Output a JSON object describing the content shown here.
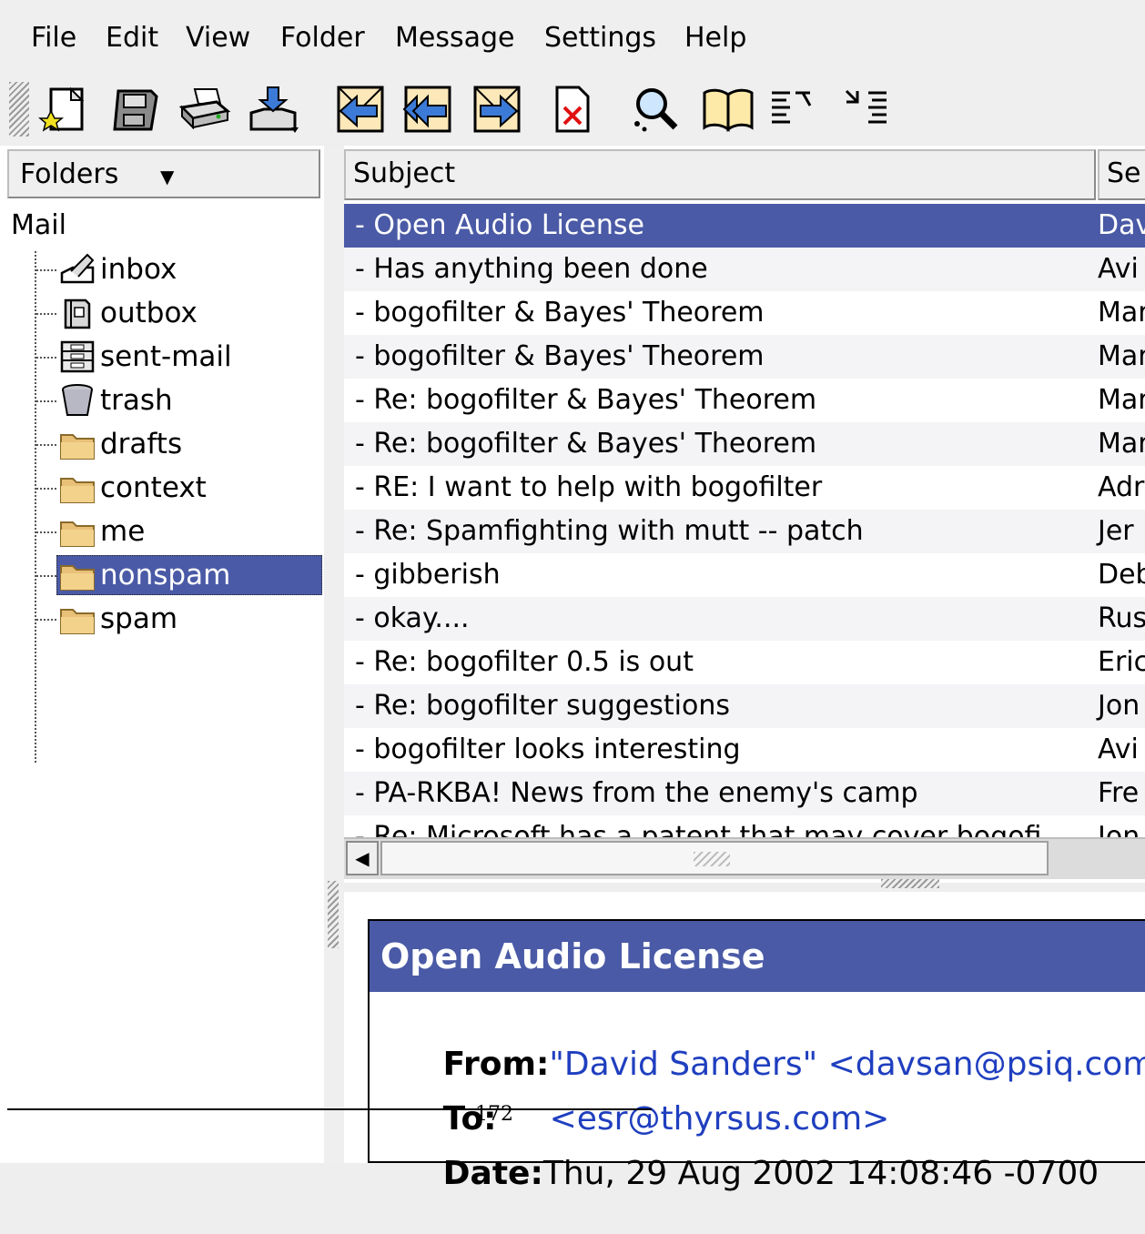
{
  "menubar": {
    "items": [
      "File",
      "Edit",
      "View",
      "Folder",
      "Message",
      "Settings",
      "Help"
    ]
  },
  "toolbar": {
    "buttons": [
      {
        "name": "new-message-icon"
      },
      {
        "name": "save-icon"
      },
      {
        "name": "print-icon"
      },
      {
        "name": "check-mail-icon"
      },
      {
        "name": "reply-icon"
      },
      {
        "name": "reply-all-icon"
      },
      {
        "name": "forward-icon"
      },
      {
        "name": "delete-icon"
      },
      {
        "name": "search-icon"
      },
      {
        "name": "address-book-icon"
      },
      {
        "name": "previous-unread-icon"
      },
      {
        "name": "next-unread-icon"
      }
    ]
  },
  "folders": {
    "header": "Folders",
    "root": "Mail",
    "items": [
      {
        "label": "inbox",
        "icon": "inbox-icon"
      },
      {
        "label": "outbox",
        "icon": "outbox-icon"
      },
      {
        "label": "sent-mail",
        "icon": "sent-mail-icon"
      },
      {
        "label": "trash",
        "icon": "trash-icon"
      },
      {
        "label": "drafts",
        "icon": "folder-icon"
      },
      {
        "label": "context",
        "icon": "folder-icon"
      },
      {
        "label": "me",
        "icon": "folder-icon"
      },
      {
        "label": "nonspam",
        "icon": "folder-icon",
        "selected": true
      },
      {
        "label": "spam",
        "icon": "folder-icon"
      }
    ]
  },
  "messages": {
    "columns": [
      "Subject",
      "Se"
    ],
    "rows": [
      {
        "subject": "- Open Audio License",
        "sender": "Dav",
        "selected": true
      },
      {
        "subject": "- Has anything been done",
        "sender": "Avi"
      },
      {
        "subject": "- bogofilter & Bayes' Theorem",
        "sender": "Mar"
      },
      {
        "subject": "- bogofilter & Bayes' Theorem",
        "sender": "Mar"
      },
      {
        "subject": "- Re: bogofilter & Bayes' Theorem",
        "sender": "Mar"
      },
      {
        "subject": "- Re: bogofilter & Bayes' Theorem",
        "sender": "Mar"
      },
      {
        "subject": "- RE: I want to help with bogofilter",
        "sender": "Adr"
      },
      {
        "subject": "- Re: Spamfighting with mutt -- patch",
        "sender": "Jer"
      },
      {
        "subject": "- gibberish",
        "sender": "Deb"
      },
      {
        "subject": "- okay....",
        "sender": "Rus"
      },
      {
        "subject": "- Re: bogofilter 0.5 is out",
        "sender": "Eric"
      },
      {
        "subject": "- Re: bogofilter suggestions",
        "sender": "Jon"
      },
      {
        "subject": "- bogofilter looks interesting",
        "sender": "Avi"
      },
      {
        "subject": "- PA-RKBA! News from the enemy's camp",
        "sender": "Fre"
      },
      {
        "subject": "- Re: Microsoft has a patent that may cover bogofi",
        "sender": "Jon"
      }
    ]
  },
  "preview": {
    "title": "Open Audio License",
    "from_label": "From:",
    "from_value": "\"David Sanders\" <davsan@psiq.com>",
    "to_label": "To:",
    "to_value": "<esr@thyrsus.com>",
    "date_label": "Date:",
    "date_value": "Thu, 29 Aug 2002 14:08:46 -0700"
  },
  "page_number": "172"
}
